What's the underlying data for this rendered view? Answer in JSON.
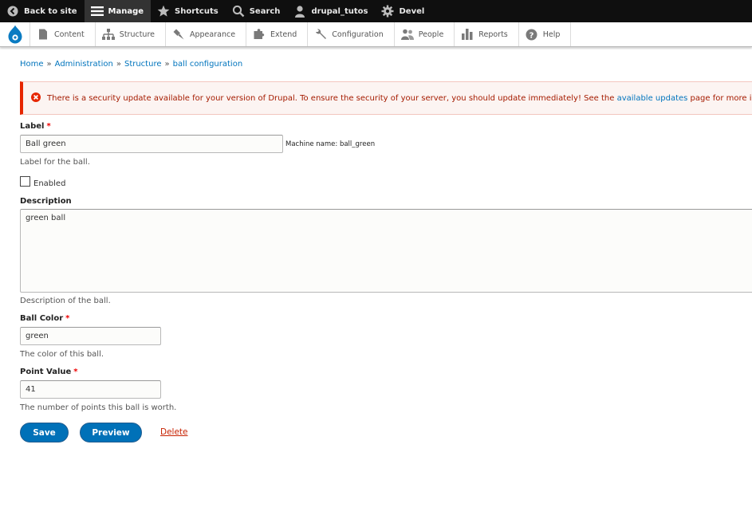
{
  "toolbar": {
    "back_to_site": "Back to site",
    "manage": "Manage",
    "shortcuts": "Shortcuts",
    "search": "Search",
    "user": "drupal_tutos",
    "devel": "Devel"
  },
  "tray": {
    "items": [
      "Content",
      "Structure",
      "Appearance",
      "Extend",
      "Configuration",
      "People",
      "Reports",
      "Help"
    ]
  },
  "breadcrumb": {
    "items": [
      "Home",
      "Administration",
      "Structure",
      "ball configuration"
    ],
    "separator": "»"
  },
  "message": {
    "text_before": "There is a security update available for your version of Drupal. To ensure the security of your server, you should update immediately! See the",
    "link": "available updates",
    "text_after": "page for more information."
  },
  "form": {
    "label_title": "Label",
    "label_value": "Ball green",
    "machine_name": "Machine name: ball_green",
    "label_desc": "Label for the ball.",
    "enabled_label": "Enabled",
    "description_title": "Description",
    "description_value": "green ball",
    "description_desc": "Description of the ball.",
    "color_title": "Ball Color",
    "color_value": "green",
    "color_desc": "The color of this ball.",
    "points_title": "Point Value",
    "points_value": "41",
    "points_desc": "The number of points this ball is worth.",
    "required_marker": "*"
  },
  "actions": {
    "save": "Save",
    "preview": "Preview",
    "delete": "Delete"
  },
  "colors": {
    "accent": "#0071b8",
    "link": "#0074bd",
    "error": "#e62600",
    "required": "#ee0000"
  }
}
